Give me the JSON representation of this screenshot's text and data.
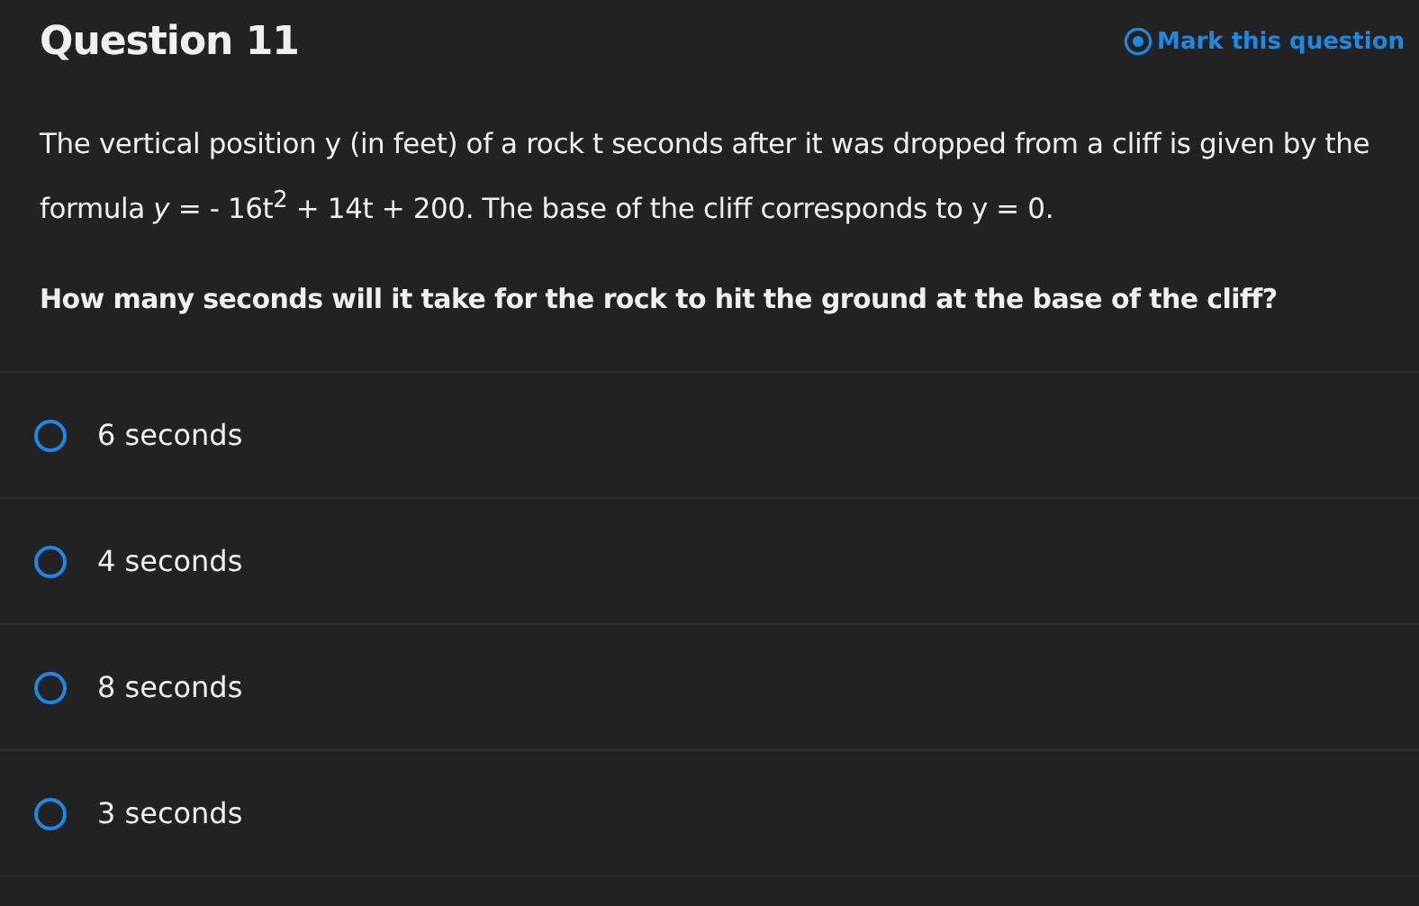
{
  "title": "Question 11",
  "mark_question": {
    "label": "Mark this question",
    "marked": false
  },
  "stem": "The vertical position y (in feet) of a rock t seconds after it was dropped from a cliff is given by the formula *y* =  - 16t$^{2}$ + 14t + 200. The base of the cliff corresponds to y = 0.",
  "prompt": "How many seconds will it take for the rock to hit the ground at the base of the cliff?",
  "options": [
    {
      "label": "6 seconds",
      "selected": false
    },
    {
      "label": "4 seconds",
      "selected": false
    },
    {
      "label": "8 seconds",
      "selected": false
    },
    {
      "label": "3 seconds",
      "selected": false
    }
  ]
}
